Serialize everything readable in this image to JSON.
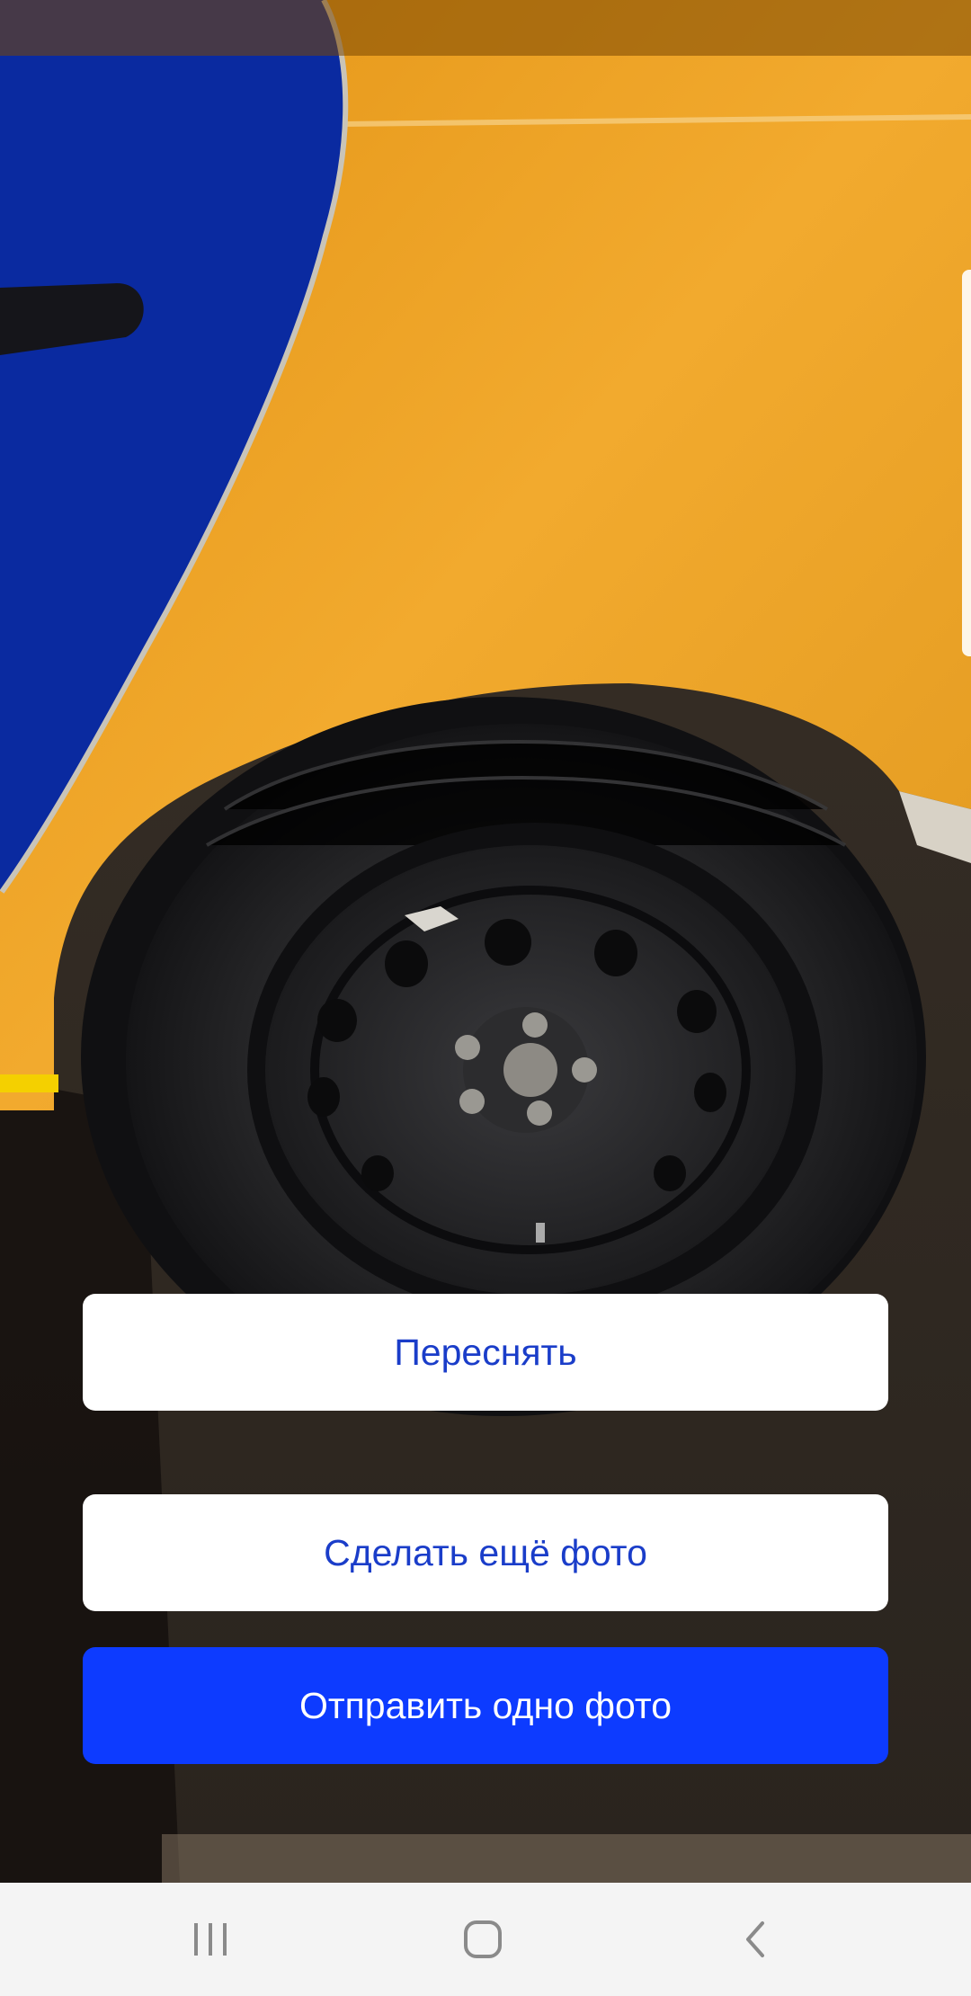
{
  "actions": {
    "retake_label": "Переснять",
    "more_photo_label": "Сделать ещё фото",
    "send_one_label": "Отправить одно фото"
  },
  "navigation_bar": {
    "recents_icon": "recents-icon",
    "home_icon": "home-icon",
    "back_icon": "back-icon"
  },
  "colors": {
    "primary_button": "#0d3bff",
    "secondary_button_text": "#1a3dc9",
    "car_body": "#f0a326",
    "car_door": "#0a2aa0"
  }
}
